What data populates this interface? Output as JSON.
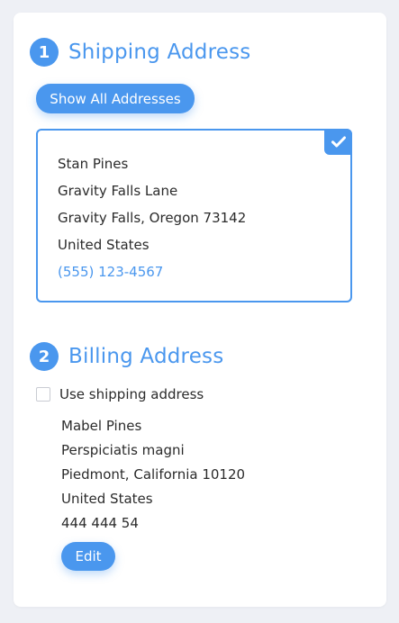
{
  "shipping": {
    "step_number": "1",
    "title": "Shipping Address",
    "show_all_label": "Show All Addresses",
    "selected_address": {
      "name": "Stan Pines",
      "street": "Gravity Falls Lane",
      "city_line": "Gravity Falls, Oregon 73142",
      "country": "United States",
      "phone": "(555) 123-4567"
    }
  },
  "billing": {
    "step_number": "2",
    "title": "Billing Address",
    "use_shipping_label": "Use shipping address",
    "use_shipping_checked": false,
    "address": {
      "name": "Mabel Pines",
      "street": "Perspiciatis magni",
      "city_line": "Piedmont, California 10120",
      "country": "United States",
      "phone": "444 444 54"
    },
    "edit_label": "Edit"
  },
  "colors": {
    "accent": "#4a97ee",
    "background": "#eef0f5",
    "card": "#ffffff"
  }
}
